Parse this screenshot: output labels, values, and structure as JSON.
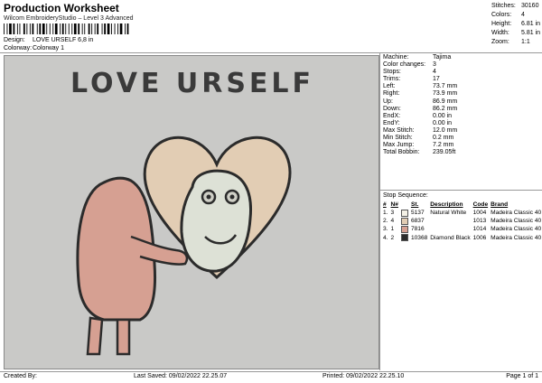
{
  "header": {
    "title": "Production Worksheet",
    "subtitle": "Wilcom EmbroideryStudio – Level 3 Advanced",
    "design_label": "Design:",
    "design_value": "LOVE URSELF 6,8 in",
    "colorway_label": "Colorway:",
    "colorway_value": "Colorway 1"
  },
  "top_stats": [
    {
      "label": "Stitches:",
      "value": "30160"
    },
    {
      "label": "Colors:",
      "value": "4"
    },
    {
      "label": "Height:",
      "value": "6.81 in"
    },
    {
      "label": "Width:",
      "value": "5.81 in"
    },
    {
      "label": "Zoom:",
      "value": "1:1"
    }
  ],
  "artwork_text": "LOVE URSELF",
  "params": [
    {
      "label": "Machine:",
      "value": "Tajima"
    },
    {
      "label": "Color changes:",
      "value": "3"
    },
    {
      "label": "Stops:",
      "value": "4"
    },
    {
      "label": "Trims:",
      "value": "17"
    },
    {
      "label": "Left:",
      "value": "73.7 mm"
    },
    {
      "label": "Right:",
      "value": "73.9 mm"
    },
    {
      "label": "Up:",
      "value": "86.9 mm"
    },
    {
      "label": "Down:",
      "value": "86.2 mm"
    },
    {
      "label": "EndX:",
      "value": "0.00 in"
    },
    {
      "label": "EndY:",
      "value": "0.00 in"
    },
    {
      "label": "Max Stitch:",
      "value": "12.0 mm"
    },
    {
      "label": "Min Stitch:",
      "value": "0.2 mm"
    },
    {
      "label": "Max Jump:",
      "value": "7.2 mm"
    },
    {
      "label": "Total Bobbin:",
      "value": "239.05ft"
    }
  ],
  "stop_sequence": {
    "title": "Stop Sequence:",
    "columns": [
      "#",
      "N#",
      "",
      "St.",
      "Description",
      "Code",
      "Brand"
    ],
    "rows": [
      {
        "stop": "1.",
        "n": "3",
        "color": "#f4f1e6",
        "st": "5137",
        "desc": "Natural White",
        "code": "1004",
        "brand": "Madeira Classic 40"
      },
      {
        "stop": "2.",
        "n": "4",
        "color": "#e2cdb4",
        "st": "6837",
        "desc": "",
        "code": "1013",
        "brand": "Madeira Classic 40"
      },
      {
        "stop": "3.",
        "n": "1",
        "color": "#d6a092",
        "st": "7816",
        "desc": "",
        "code": "1014",
        "brand": "Madeira Classic 40"
      },
      {
        "stop": "4.",
        "n": "2",
        "color": "#2b2b2b",
        "st": "10368",
        "desc": "Diamond Black",
        "code": "1006",
        "brand": "Madeira Classic 40"
      }
    ]
  },
  "footer": {
    "created_by": "Created By:",
    "last_saved": "Last Saved: 09/02/2022 22.25.07",
    "printed": "Printed: 09/02/2022 22.25.10",
    "page": "Page 1 of 1"
  }
}
